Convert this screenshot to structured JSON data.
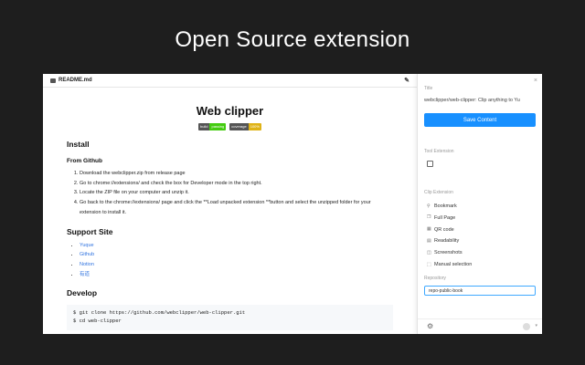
{
  "banner": {
    "title": "Open Source extension"
  },
  "readme": {
    "filename": "README.md",
    "title": "Web clipper",
    "badges": [
      {
        "label": "build",
        "value": "passing",
        "color": "#44cc11"
      },
      {
        "label": "coverage",
        "value": "100%",
        "color": "#dfb317"
      }
    ],
    "install_heading": "Install",
    "from_github": "From Github",
    "steps": [
      "Download the webclipper.zip from release page",
      "Go to chrome://extensions/ and check the box for Developer mode in the top right.",
      "Locate the ZIP file on your computer and unzip it.",
      "Go back to the chrome://extensions/ page and click the **Load unpacked extension **button and select the unzipped folder for your extension to install it."
    ],
    "support_heading": "Support Site",
    "support_sites": [
      "Yuque",
      "Github",
      "Notion",
      "有道"
    ],
    "develop_heading": "Develop",
    "code_lines": [
      "$ git clone https://github.com/webclipper/web-clipper.git",
      "$ cd web-clipper"
    ]
  },
  "panel": {
    "close": "×",
    "title_label": "Title",
    "title_value": "webclipper/web-clipper: Clip anything to Yu",
    "save_button": "Save Content",
    "tool_label": "Tool Extension",
    "clip_label": "Clip Extension",
    "clip_items": [
      "Bookmark",
      "Full Page",
      "QR code",
      "Readability",
      "Screenshots",
      "Manual selection"
    ],
    "repo_label": "Repository",
    "repo_value": "repo-public-book"
  },
  "colors": {
    "accent": "#1890ff",
    "background": "#1e1e1e",
    "link": "#2f73e0"
  }
}
